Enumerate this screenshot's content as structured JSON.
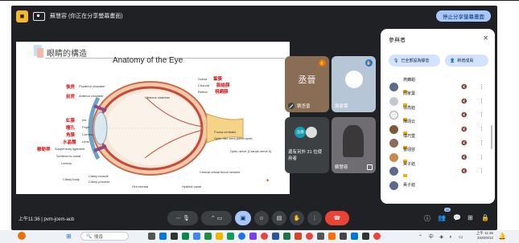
{
  "meeting": {
    "presenting_text": "蘇慧容 (你正在分享螢幕畫面)",
    "stop_sharing_label": "停止分享螢幕畫面",
    "time": "上午11:36",
    "meeting_code": "pvm-jcem-acb"
  },
  "slide": {
    "title": "眼睛的構造",
    "diagram_title": "Anatomy of the Eye",
    "labels_en": [
      "Posterior chamber",
      "Anterior chamber",
      "Iris",
      "Pupil",
      "Cornea",
      "Lens",
      "Suspensory ligament",
      "Schlemm's canal",
      "Limbus",
      "Ciliary muscle",
      "Ciliary process",
      "Ciliary body",
      "Ora serrata",
      "Sclera",
      "Choroid",
      "Retina",
      "Vitreous chamber",
      "Fovea centralis",
      "Optic disc area (blind spot)",
      "Optic nerve (Cranial nerve II)",
      "Central retinal blood vessels",
      "Hyaloid canal"
    ],
    "labels_zh": [
      "後房",
      "前房",
      "虹膜",
      "瞳孔",
      "角膜",
      "水晶體",
      "懸韌帶",
      "鞏膜",
      "脈絡膜",
      "視網膜"
    ]
  },
  "tiles": [
    {
      "name": "劉丞普",
      "avatar_text": "丞晉",
      "color": "#8a6d55"
    },
    {
      "name": "周家葉",
      "color": "#b7c6d6"
    },
    {
      "name": "還有另外 31 位使用者",
      "avatar_text": "品璁",
      "color": "#3c4043"
    },
    {
      "name": "蘇慧容",
      "color": "#6f6d72"
    }
  ],
  "panel": {
    "title": "參與者",
    "mute_all_label": "已全部設為靜音",
    "add_people_label": "新增成員",
    "participants": [
      {
        "name": "燕鏵甜",
        "avatar_color": "#5f6a8a"
      },
      {
        "name": "周家葉",
        "avatar_color": "#c4c9d1"
      },
      {
        "name": "徐亮鈺",
        "avatar_color": "#ffffff"
      },
      {
        "name": "陳翊云",
        "avatar_color": "#7a5a3a"
      },
      {
        "name": "傅巧萱",
        "avatar_color": "#8b6b5a"
      },
      {
        "name": "曹翊容",
        "avatar_color": "#c98a4a"
      },
      {
        "name": "黃子鈺",
        "avatar_color": "#5f6a8a"
      },
      {
        "name": "黃子鈺",
        "avatar_color": "#5f6a8a"
      }
    ]
  },
  "taskbar": {
    "search_placeholder": "搜尋",
    "clock_time": "上午 11:36",
    "clock_date": "2025/9/12"
  },
  "participant_count_badge": "35"
}
